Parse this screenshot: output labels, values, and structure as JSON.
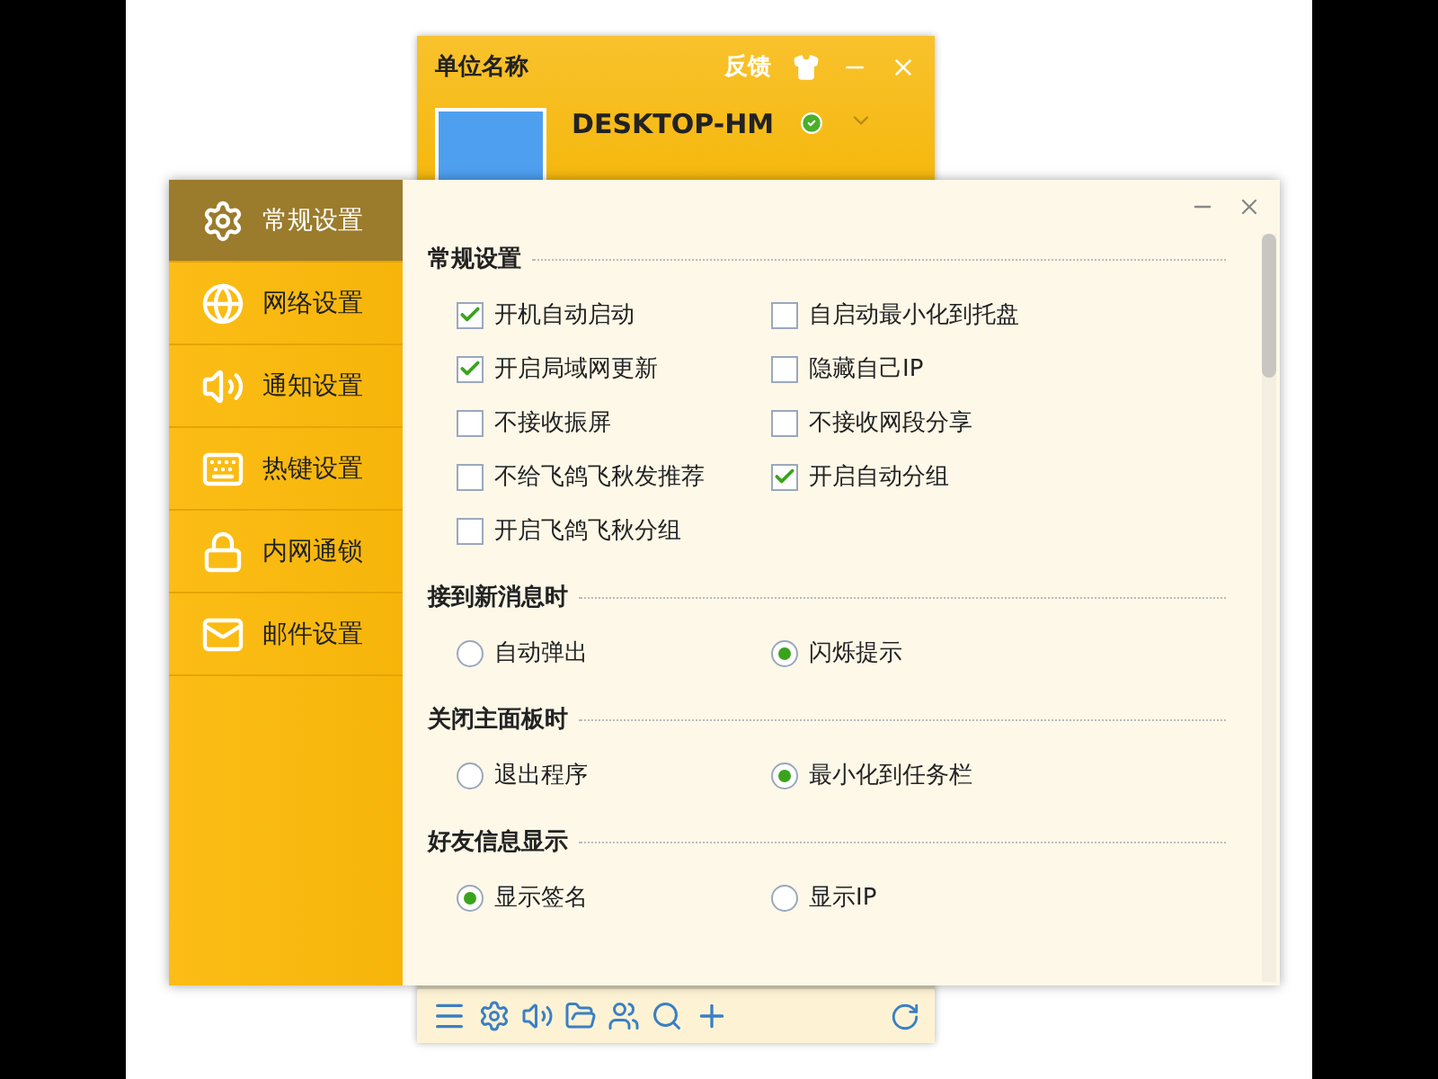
{
  "main_window": {
    "title": "单位名称",
    "feedback": "反馈",
    "user": {
      "name": "DESKTOP-HM",
      "online": true
    }
  },
  "settings": {
    "nav": [
      {
        "label": "常规设置",
        "selected": true,
        "kind": "gear"
      },
      {
        "label": "网络设置",
        "selected": false,
        "kind": "globe"
      },
      {
        "label": "通知设置",
        "selected": false,
        "kind": "sound"
      },
      {
        "label": "热键设置",
        "selected": false,
        "kind": "keyboard"
      },
      {
        "label": "内网通锁",
        "selected": false,
        "kind": "lock"
      },
      {
        "label": "邮件设置",
        "selected": false,
        "kind": "mail"
      }
    ],
    "sections": [
      {
        "title": "常规设置",
        "kind": "checkbox",
        "options": [
          {
            "label": "开机自动启动",
            "checked": true
          },
          {
            "label": "自启动最小化到托盘",
            "checked": false
          },
          {
            "label": "开启局域网更新",
            "checked": true
          },
          {
            "label": "隐藏自己IP",
            "checked": false
          },
          {
            "label": "不接收振屏",
            "checked": false
          },
          {
            "label": "不接收网段分享",
            "checked": false
          },
          {
            "label": "不给飞鸽飞秋发推荐",
            "checked": false
          },
          {
            "label": "开启自动分组",
            "checked": true
          },
          {
            "label": "开启飞鸽飞秋分组",
            "checked": false
          }
        ]
      },
      {
        "title": "接到新消息时",
        "kind": "radio",
        "options": [
          {
            "label": "自动弹出",
            "selected": false
          },
          {
            "label": "闪烁提示",
            "selected": true
          }
        ]
      },
      {
        "title": "关闭主面板时",
        "kind": "radio",
        "options": [
          {
            "label": "退出程序",
            "selected": false
          },
          {
            "label": "最小化到任务栏",
            "selected": true
          }
        ]
      },
      {
        "title": "好友信息显示",
        "kind": "radio",
        "options": [
          {
            "label": "显示签名",
            "selected": true
          },
          {
            "label": "显示IP",
            "selected": false
          }
        ]
      }
    ]
  }
}
